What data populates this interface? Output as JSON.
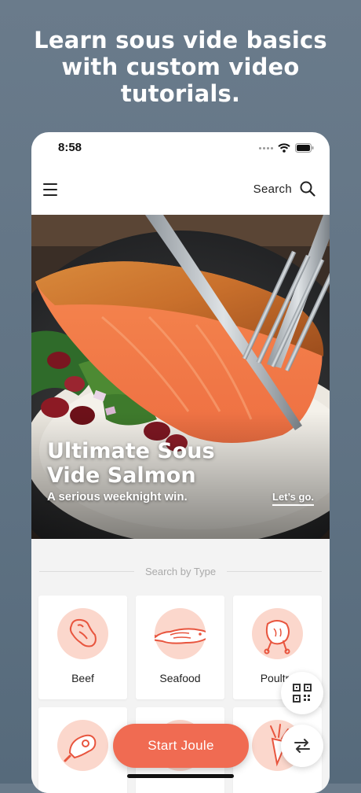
{
  "headline": "Learn sous vide basics\nwith custom video\ntutorials.",
  "status_bar": {
    "time": "8:58"
  },
  "navbar": {
    "search_label": "Search"
  },
  "hero": {
    "title": "Ultimate Sous\nVide Salmon",
    "subtitle": "A serious weeknight win.",
    "cta": "Let’s go."
  },
  "search_by_type": {
    "title": "Search by Type",
    "cards": [
      {
        "label": "Beef",
        "icon": "steak-icon"
      },
      {
        "label": "Seafood",
        "icon": "fish-icon"
      },
      {
        "label": "Poultry",
        "icon": "chicken-icon"
      },
      {
        "label": "",
        "icon": "pork-chop-icon"
      },
      {
        "label": "",
        "icon": "egg-icon"
      },
      {
        "label": "",
        "icon": "carrot-icon"
      }
    ]
  },
  "actions": {
    "start_label": "Start Joule",
    "qr_icon": "qr-code-icon",
    "swap_icon": "swap-arrows-icon"
  },
  "colors": {
    "accent": "#f06b52",
    "icon_circle": "#fbd7cc",
    "icon_stroke": "#e8553e",
    "background": "#62768a"
  }
}
